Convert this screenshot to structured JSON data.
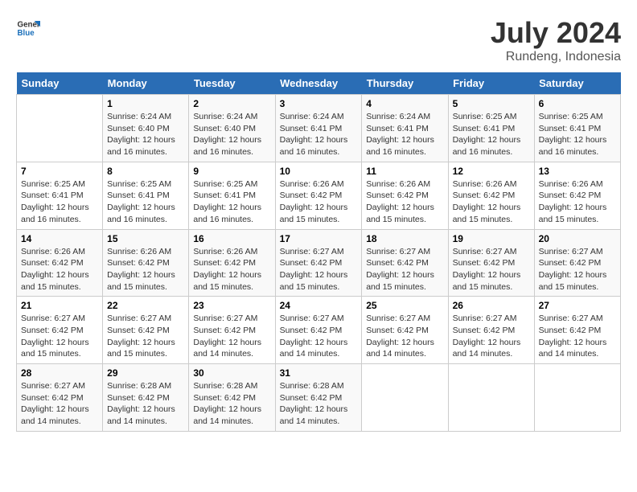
{
  "logo": {
    "line1": "General",
    "line2": "Blue"
  },
  "title": {
    "month_year": "July 2024",
    "location": "Rundeng, Indonesia"
  },
  "headers": [
    "Sunday",
    "Monday",
    "Tuesday",
    "Wednesday",
    "Thursday",
    "Friday",
    "Saturday"
  ],
  "weeks": [
    [
      {
        "num": "",
        "info": ""
      },
      {
        "num": "1",
        "info": "Sunrise: 6:24 AM\nSunset: 6:40 PM\nDaylight: 12 hours and 16 minutes."
      },
      {
        "num": "2",
        "info": "Sunrise: 6:24 AM\nSunset: 6:40 PM\nDaylight: 12 hours and 16 minutes."
      },
      {
        "num": "3",
        "info": "Sunrise: 6:24 AM\nSunset: 6:41 PM\nDaylight: 12 hours and 16 minutes."
      },
      {
        "num": "4",
        "info": "Sunrise: 6:24 AM\nSunset: 6:41 PM\nDaylight: 12 hours and 16 minutes."
      },
      {
        "num": "5",
        "info": "Sunrise: 6:25 AM\nSunset: 6:41 PM\nDaylight: 12 hours and 16 minutes."
      },
      {
        "num": "6",
        "info": "Sunrise: 6:25 AM\nSunset: 6:41 PM\nDaylight: 12 hours and 16 minutes."
      }
    ],
    [
      {
        "num": "7",
        "info": "Sunrise: 6:25 AM\nSunset: 6:41 PM\nDaylight: 12 hours and 16 minutes."
      },
      {
        "num": "8",
        "info": "Sunrise: 6:25 AM\nSunset: 6:41 PM\nDaylight: 12 hours and 16 minutes."
      },
      {
        "num": "9",
        "info": "Sunrise: 6:25 AM\nSunset: 6:41 PM\nDaylight: 12 hours and 16 minutes."
      },
      {
        "num": "10",
        "info": "Sunrise: 6:26 AM\nSunset: 6:42 PM\nDaylight: 12 hours and 15 minutes."
      },
      {
        "num": "11",
        "info": "Sunrise: 6:26 AM\nSunset: 6:42 PM\nDaylight: 12 hours and 15 minutes."
      },
      {
        "num": "12",
        "info": "Sunrise: 6:26 AM\nSunset: 6:42 PM\nDaylight: 12 hours and 15 minutes."
      },
      {
        "num": "13",
        "info": "Sunrise: 6:26 AM\nSunset: 6:42 PM\nDaylight: 12 hours and 15 minutes."
      }
    ],
    [
      {
        "num": "14",
        "info": "Sunrise: 6:26 AM\nSunset: 6:42 PM\nDaylight: 12 hours and 15 minutes."
      },
      {
        "num": "15",
        "info": "Sunrise: 6:26 AM\nSunset: 6:42 PM\nDaylight: 12 hours and 15 minutes."
      },
      {
        "num": "16",
        "info": "Sunrise: 6:26 AM\nSunset: 6:42 PM\nDaylight: 12 hours and 15 minutes."
      },
      {
        "num": "17",
        "info": "Sunrise: 6:27 AM\nSunset: 6:42 PM\nDaylight: 12 hours and 15 minutes."
      },
      {
        "num": "18",
        "info": "Sunrise: 6:27 AM\nSunset: 6:42 PM\nDaylight: 12 hours and 15 minutes."
      },
      {
        "num": "19",
        "info": "Sunrise: 6:27 AM\nSunset: 6:42 PM\nDaylight: 12 hours and 15 minutes."
      },
      {
        "num": "20",
        "info": "Sunrise: 6:27 AM\nSunset: 6:42 PM\nDaylight: 12 hours and 15 minutes."
      }
    ],
    [
      {
        "num": "21",
        "info": "Sunrise: 6:27 AM\nSunset: 6:42 PM\nDaylight: 12 hours and 15 minutes."
      },
      {
        "num": "22",
        "info": "Sunrise: 6:27 AM\nSunset: 6:42 PM\nDaylight: 12 hours and 15 minutes."
      },
      {
        "num": "23",
        "info": "Sunrise: 6:27 AM\nSunset: 6:42 PM\nDaylight: 12 hours and 14 minutes."
      },
      {
        "num": "24",
        "info": "Sunrise: 6:27 AM\nSunset: 6:42 PM\nDaylight: 12 hours and 14 minutes."
      },
      {
        "num": "25",
        "info": "Sunrise: 6:27 AM\nSunset: 6:42 PM\nDaylight: 12 hours and 14 minutes."
      },
      {
        "num": "26",
        "info": "Sunrise: 6:27 AM\nSunset: 6:42 PM\nDaylight: 12 hours and 14 minutes."
      },
      {
        "num": "27",
        "info": "Sunrise: 6:27 AM\nSunset: 6:42 PM\nDaylight: 12 hours and 14 minutes."
      }
    ],
    [
      {
        "num": "28",
        "info": "Sunrise: 6:27 AM\nSunset: 6:42 PM\nDaylight: 12 hours and 14 minutes."
      },
      {
        "num": "29",
        "info": "Sunrise: 6:28 AM\nSunset: 6:42 PM\nDaylight: 12 hours and 14 minutes."
      },
      {
        "num": "30",
        "info": "Sunrise: 6:28 AM\nSunset: 6:42 PM\nDaylight: 12 hours and 14 minutes."
      },
      {
        "num": "31",
        "info": "Sunrise: 6:28 AM\nSunset: 6:42 PM\nDaylight: 12 hours and 14 minutes."
      },
      {
        "num": "",
        "info": ""
      },
      {
        "num": "",
        "info": ""
      },
      {
        "num": "",
        "info": ""
      }
    ]
  ]
}
